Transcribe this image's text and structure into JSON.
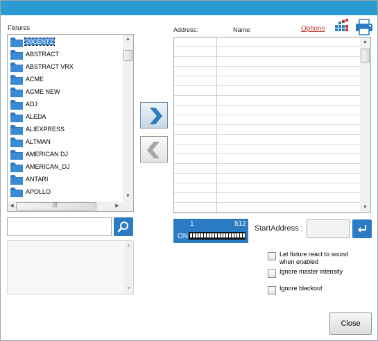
{
  "colors": {
    "accent": "#2b9bd3",
    "button_blue": "#2b7cc4",
    "folder_blue": "#2f79c2",
    "options_link": "#c0392b"
  },
  "labels": {
    "fixtures": "Fixtures",
    "address": "Address:",
    "name": "Name:",
    "options": "Options",
    "start_address": "StartAddress :",
    "close": "Close"
  },
  "fixtures": {
    "items": [
      "20CENTZ",
      "ABSTRACT",
      "ABSTRACT VRX",
      "ACME",
      "ACME NEW",
      "ADJ",
      "ALEDA",
      "ALIEXPRESS",
      "ALTMAN",
      "AMERICAN DJ",
      "AMERICAN_DJ",
      "ANTARI",
      "APOLLO"
    ],
    "selected_index": 0,
    "item_icon": "folder-icon"
  },
  "dmx": {
    "range_start": "1",
    "range_end": "512",
    "state": "ON"
  },
  "options_checkboxes": [
    {
      "label_line1": "Let fixture react to sound",
      "label_line2": "when enabled",
      "checked": false
    },
    {
      "label_line1": "Ignore master intensity",
      "label_line2": "",
      "checked": false
    },
    {
      "label_line1": "Ignore blackout",
      "label_line2": "",
      "checked": false
    }
  ],
  "icons": {
    "toolbar": [
      "dmx-grid-icon",
      "printer-icon"
    ],
    "search": "search-icon",
    "add": "arrow-right-icon",
    "remove": "arrow-left-icon",
    "enter": "enter-icon"
  }
}
